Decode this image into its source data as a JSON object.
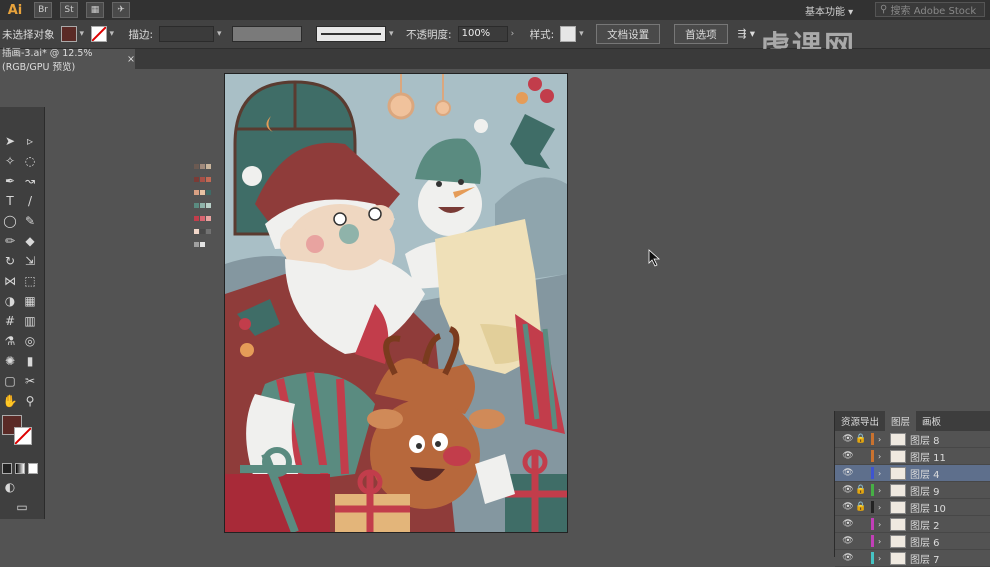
{
  "menubar": {
    "ai_label": "Ai",
    "br_label": "Br",
    "st_label": "St",
    "workspace": "基本功能",
    "search_placeholder": "搜索 Adobe Stock"
  },
  "control": {
    "selection_label": "未选择对象",
    "fill_color": "#5a2a26",
    "stroke_label": "描边:",
    "opacity_label": "不透明度:",
    "opacity_value": "100%",
    "style_label": "样式:",
    "doc_settings": "文档设置",
    "preferences": "首选项"
  },
  "tab": {
    "title": "插画-3.ai* @ 12.5% (RGB/GPU 预览)"
  },
  "watermark": "虎课网",
  "layers_panel": {
    "tabs": [
      "资源导出",
      "图层",
      "画板"
    ],
    "active_tab": "图层",
    "rows": [
      {
        "name": "图层 8",
        "bar": "#c9722f",
        "selected": false,
        "locked": true
      },
      {
        "name": "图层 11",
        "bar": "#c9722f",
        "selected": false,
        "locked": false
      },
      {
        "name": "图层 4",
        "bar": "#3e55d1",
        "selected": true,
        "locked": false
      },
      {
        "name": "图层 9",
        "bar": "#46b045",
        "selected": false,
        "locked": true
      },
      {
        "name": "图层 10",
        "bar": "#222222",
        "selected": false,
        "locked": true
      },
      {
        "name": "图层 2",
        "bar": "#c23fb8",
        "selected": false,
        "locked": false
      },
      {
        "name": "图层 6",
        "bar": "#c23fb8",
        "selected": false,
        "locked": false
      },
      {
        "name": "图层 7",
        "bar": "#46c4c4",
        "selected": false,
        "locked": false
      }
    ]
  },
  "palette": [
    "#6b5a52",
    "#a08a7c",
    "#c9b59c",
    "#7a3b36",
    "#a85047",
    "#c26a55",
    "#d9a083",
    "#e7c2a4",
    "#3e6b66",
    "#5a8b80",
    "#8fb3aa",
    "#b8d0c8",
    "#c23d4b",
    "#d86470",
    "#e9a3a0",
    "#f1d7c9",
    "#4a4a4a",
    "#727272",
    "#a0a0a0",
    "#e3e3e3"
  ]
}
